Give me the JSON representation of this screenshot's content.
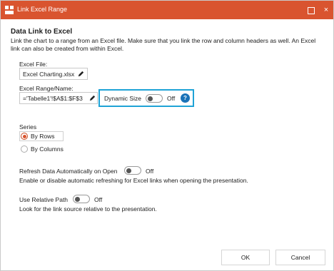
{
  "window": {
    "title": "Link Excel Range",
    "accent": "#d9542f"
  },
  "section": {
    "heading": "Data Link to Excel",
    "description": "Link the chart to a range from an Excel file. Make sure that you link the row and column headers as well. An Excel link can also be created from within Excel."
  },
  "excel_file": {
    "label": "Excel File:",
    "value": "Excel Charting.xlsx"
  },
  "excel_range": {
    "label": "Excel Range/Name:",
    "value": "='Tabelle1'!$A$1:$F$3"
  },
  "dynamic_size": {
    "label": "Dynamic Size",
    "state": "Off",
    "help": "?",
    "highlight_color": "#1fa3d6"
  },
  "series": {
    "label": "Series",
    "options": [
      "By Rows",
      "By Columns"
    ],
    "selected": "By Rows"
  },
  "refresh": {
    "label": "Refresh Data Automatically on Open",
    "state": "Off",
    "description": "Enable or disable automatic refreshing for Excel links when opening the presentation."
  },
  "relative_path": {
    "label": "Use Relative Path",
    "state": "Off",
    "description": "Look for the link source relative to the presentation."
  },
  "buttons": {
    "ok": "OK",
    "cancel": "Cancel"
  },
  "titlebar_buttons": {
    "close": "×"
  }
}
